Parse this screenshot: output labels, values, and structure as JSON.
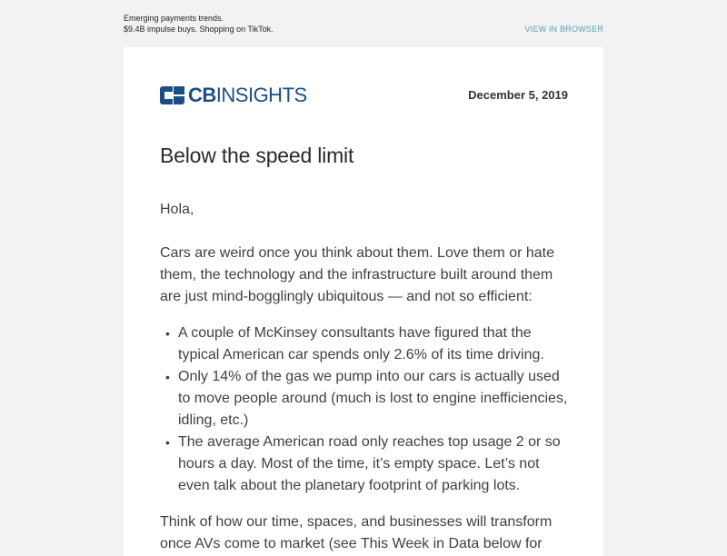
{
  "preheader": {
    "line1": "Emerging payments trends.",
    "line2": "$9.4B impulse buys. Shopping on TikTok.",
    "view_in_browser": "VIEW IN BROWSER"
  },
  "header": {
    "logo_cb": "CB",
    "logo_insights": "INSIGHTS",
    "date": "December 5, 2019"
  },
  "content": {
    "title": "Below the speed limit",
    "greeting": "Hola,",
    "intro": "Cars are weird once you think about them. Love them or hate them, the technology and the infrastructure built around them are just mind-bogglingly ubiquitous — and not so efficient:",
    "bullets": [
      "A couple of McKinsey consultants have figured that the typical American car spends only 2.6% of its time driving.",
      "Only 14% of the gas we pump into our cars is actually used to move people around (much is lost to engine inefficiencies, idling, etc.)",
      "The average American road only reaches top usage 2 or so hours a day. Most of the time, it’s empty space. Let’s not even talk about the planetary footprint of parking lots."
    ],
    "outro": "Think of how our time, spaces, and businesses will transform once AVs come to market (see This Week in Data below for"
  },
  "colors": {
    "brand": "#1b4e86",
    "link": "#5b9fb8",
    "background": "#f2f2f2"
  }
}
